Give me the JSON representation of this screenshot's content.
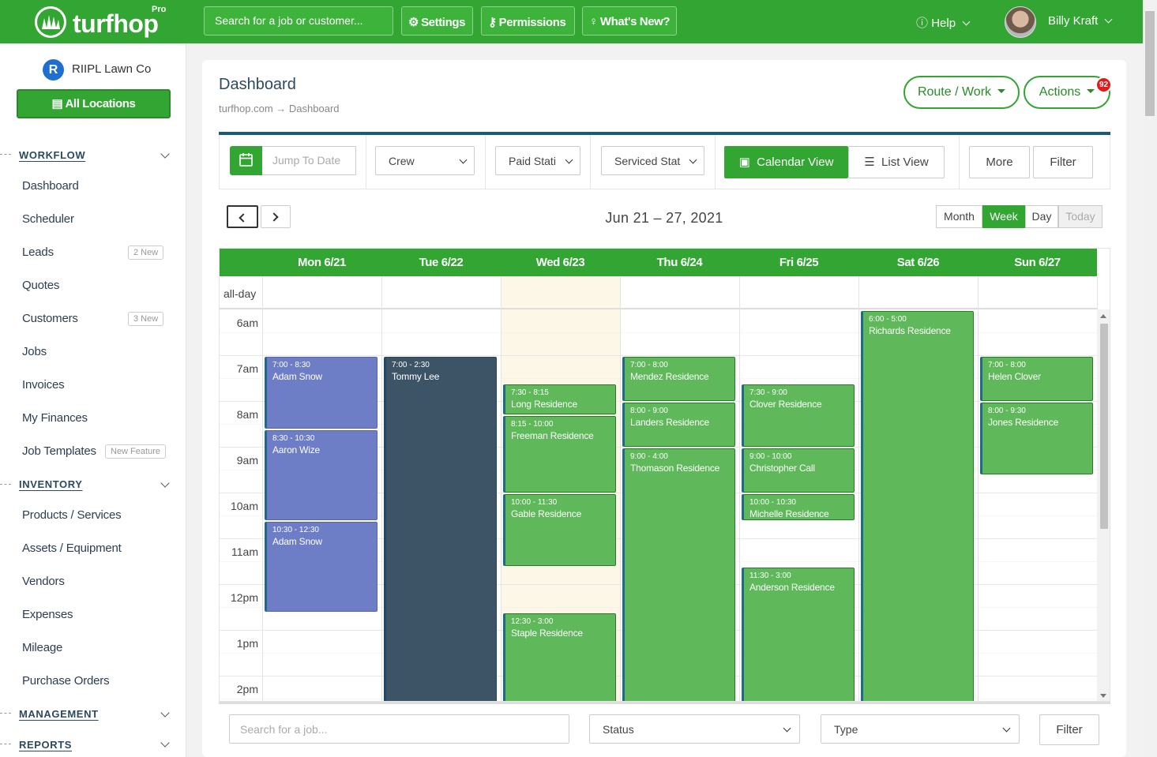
{
  "header": {
    "logo_text": "turfhop",
    "logo_badge": "Pro",
    "search_placeholder": "Search for a job or customer...",
    "buttons": [
      {
        "label": "Settings",
        "icon": "gear-icon"
      },
      {
        "label": "Permissions",
        "icon": "key-icon"
      },
      {
        "label": "What's New?",
        "icon": "lightbulb-icon"
      }
    ],
    "help_label": "Help",
    "user_name": "Billy Kraft"
  },
  "sidebar": {
    "org_initial": "R",
    "org_name": "RIIPL Lawn Co",
    "all_locations_label": "All Locations",
    "sections": [
      {
        "title": "WORKFLOW",
        "items": [
          {
            "label": "Dashboard"
          },
          {
            "label": "Scheduler"
          },
          {
            "label": "Leads",
            "badge": "2 New"
          },
          {
            "label": "Quotes"
          },
          {
            "label": "Customers",
            "badge": "3 New"
          },
          {
            "label": "Jobs"
          },
          {
            "label": "Invoices"
          },
          {
            "label": "My Finances"
          },
          {
            "label": "Job Templates",
            "badge": "New Feature"
          }
        ]
      },
      {
        "title": "INVENTORY",
        "items": [
          {
            "label": "Products / Services"
          },
          {
            "label": "Assets / Equipment"
          },
          {
            "label": "Vendors"
          },
          {
            "label": "Expenses"
          },
          {
            "label": "Mileage"
          },
          {
            "label": "Purchase Orders"
          }
        ]
      },
      {
        "title": "MANAGEMENT",
        "items": []
      },
      {
        "title": "REPORTS",
        "items": []
      }
    ]
  },
  "main": {
    "title": "Dashboard",
    "breadcrumb": [
      "turfhop.com",
      "Dashboard"
    ],
    "route_work_label": "Route / Work",
    "actions_label": "Actions",
    "actions_badge": "92",
    "toolbar": {
      "jump_placeholder": "Jump To Date",
      "crew_label": "Crew",
      "paid_label": "Paid Stati",
      "serviced_label": "Serviced Stat",
      "calendar_view_label": "Calendar View",
      "list_view_label": "List View",
      "more_label": "More",
      "filter_label": "Filter"
    },
    "calendar": {
      "range": "Jun 21 – 27, 2021",
      "views": [
        "Month",
        "Week",
        "Day",
        "Today"
      ],
      "active_view": "Week",
      "all_day_label": "all-day",
      "days": [
        "Mon 6/21",
        "Tue 6/22",
        "Wed 6/23",
        "Thu 6/24",
        "Fri 6/25",
        "Sat 6/26",
        "Sun 6/27"
      ],
      "today_index": 2,
      "hours": [
        "6am",
        "7am",
        "8am",
        "9am",
        "10am",
        "11am",
        "12pm",
        "1pm",
        "2pm"
      ],
      "events": [
        {
          "day": 0,
          "start": 7.0,
          "end": 8.6,
          "time": "7:00 - 8:30",
          "name": "Adam Snow",
          "color": "purple"
        },
        {
          "day": 0,
          "start": 8.6,
          "end": 10.6,
          "time": "8:30 - 10:30",
          "name": "Aaron Wize",
          "color": "purple"
        },
        {
          "day": 0,
          "start": 10.6,
          "end": 12.6,
          "time": "10:30 - 12:30",
          "name": "Adam Snow",
          "color": "purple"
        },
        {
          "day": 1,
          "start": 7.0,
          "end": 14.6,
          "time": "7:00 - 2:30",
          "name": "Tommy Lee",
          "color": "dark"
        },
        {
          "day": 2,
          "start": 7.6,
          "end": 8.3,
          "time": "7:30 - 8:15",
          "name": "Long Residence",
          "color": "green"
        },
        {
          "day": 2,
          "start": 8.3,
          "end": 10.0,
          "time": "8:15 - 10:00",
          "name": "Freeman Residence",
          "color": "green"
        },
        {
          "day": 2,
          "start": 10.0,
          "end": 11.6,
          "time": "10:00 - 11:30",
          "name": "Gable Residence",
          "color": "green"
        },
        {
          "day": 2,
          "start": 12.6,
          "end": 14.6,
          "time": "12:30 - 3:00",
          "name": "Staple Residence",
          "color": "green"
        },
        {
          "day": 3,
          "start": 7.0,
          "end": 8.0,
          "time": "7:00 - 8:00",
          "name": "Mendez Residence",
          "color": "green"
        },
        {
          "day": 3,
          "start": 8.0,
          "end": 9.0,
          "time": "8:00 - 9:00",
          "name": "Landers Residence",
          "color": "green"
        },
        {
          "day": 3,
          "start": 9.0,
          "end": 14.6,
          "time": "9:00 - 4:00",
          "name": "Thomason Residence",
          "color": "green"
        },
        {
          "day": 4,
          "start": 7.6,
          "end": 9.0,
          "time": "7:30 - 9:00",
          "name": "Clover Residence",
          "color": "green"
        },
        {
          "day": 4,
          "start": 9.0,
          "end": 10.0,
          "time": "9:00 - 10:00",
          "name": "Christopher Call",
          "color": "green"
        },
        {
          "day": 4,
          "start": 10.0,
          "end": 10.6,
          "time": "10:00 - 10:30",
          "name": "Michelle Residence",
          "color": "green"
        },
        {
          "day": 4,
          "start": 11.6,
          "end": 14.6,
          "time": "11:30 - 3:00",
          "name": "Anderson Residence",
          "color": "green"
        },
        {
          "day": 5,
          "start": 6.0,
          "end": 14.6,
          "time": "6:00 - 5:00",
          "name": "Richards Residence",
          "color": "green"
        },
        {
          "day": 6,
          "start": 7.0,
          "end": 8.0,
          "time": "7:00 - 8:00",
          "name": "Helen Clover",
          "color": "green"
        },
        {
          "day": 6,
          "start": 8.0,
          "end": 9.6,
          "time": "8:00 - 9:30",
          "name": "Jones Residence",
          "color": "green"
        }
      ]
    },
    "bottom_filter": {
      "search_placeholder": "Search for a job...",
      "status_label": "Status",
      "type_label": "Type",
      "filter_label": "Filter"
    }
  },
  "colors": {
    "brand_green": "#33a532",
    "dark_blue": "#1a5a7a",
    "badge_red": "#e01b1b",
    "today_bg": "#fcf7e6"
  }
}
